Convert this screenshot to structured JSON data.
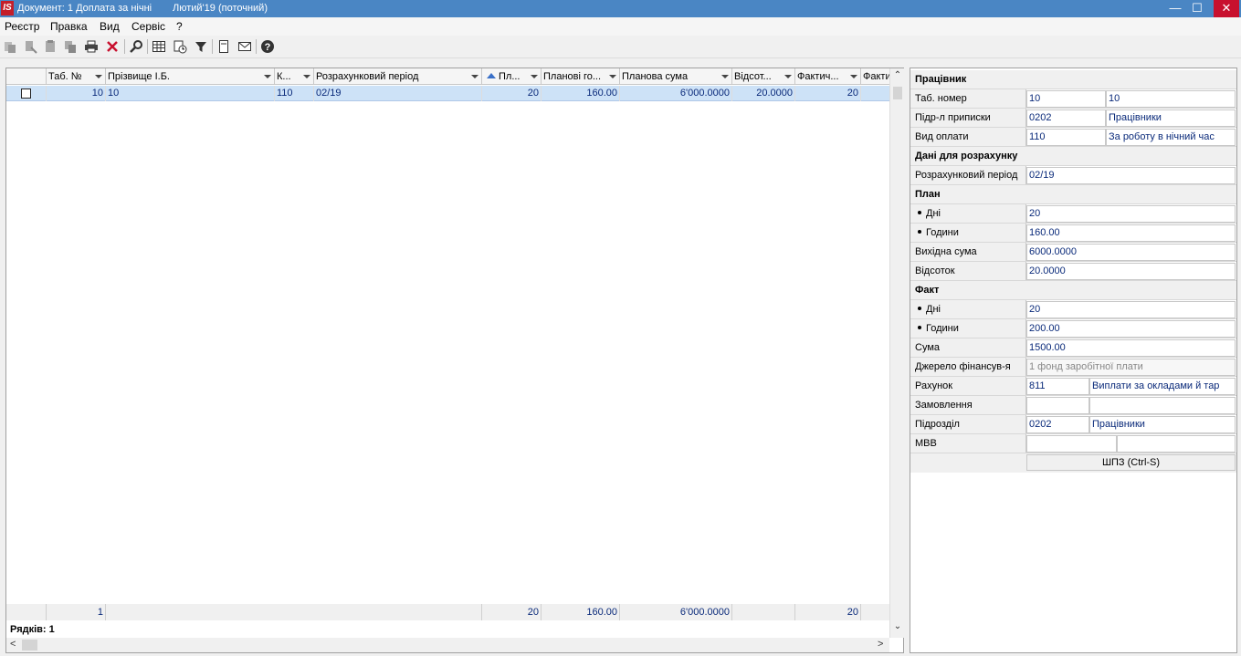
{
  "window": {
    "logo": "IS",
    "title": "Документ: 1 Доплата за нічні",
    "period": "Лютий'19 (поточний)",
    "minimize": "—",
    "maximize": "☐",
    "close": "✕"
  },
  "menu": {
    "items": [
      "Реєстр",
      "Правка",
      "Вид",
      "Сервіс",
      "?"
    ]
  },
  "toolbar": {
    "icons": [
      "copy-doc-icon",
      "cut-doc-icon",
      "paste-doc-icon",
      "duplicate-doc-icon",
      "print-icon",
      "delete-icon",
      "search-icon",
      "table-view-icon",
      "calc-icon",
      "filter-icon",
      "form-icon",
      "mail-icon",
      "help-icon"
    ],
    "colors": {
      "delete": "#c8102e",
      "icon": "#333333"
    }
  },
  "grid": {
    "columns": [
      "Таб. №",
      "Прізвище І.Б.",
      "К...",
      "Розрахунковий період",
      "Пл...",
      "Планові го...",
      "Планова сума",
      "Відсот...",
      "Фактич...",
      "Факти"
    ],
    "rows": [
      {
        "tab": "10",
        "name": "10",
        "code": "110",
        "period": "02/19",
        "plan_days": "20",
        "plan_hours": "160.00",
        "plan_sum": "6'000.0000",
        "percent": "20.0000",
        "fact_days": "20",
        "fact_more": ""
      }
    ],
    "footer": {
      "tab": "1",
      "plan_days": "20",
      "plan_hours": "160.00",
      "plan_sum": "6'000.0000",
      "fact_days": "20"
    },
    "rows_label": "Рядків: 1",
    "scroll_up": "⌃",
    "scroll_down": "⌄",
    "scroll_left": "<",
    "scroll_right": ">"
  },
  "panel": {
    "worker_section": "Працівник",
    "tab_label": "Таб. номер",
    "tab_code": "10",
    "tab_name": "10",
    "dept_label": "Підр-л приписки",
    "dept_code": "0202",
    "dept_name": "Працівники",
    "pay_label": "Вид оплати",
    "pay_code": "110",
    "pay_name": "За роботу в нічний час",
    "calc_section": "Дані для розрахунку",
    "period_label": "Розрахунковий період",
    "period_value": "02/19",
    "plan_section": "План",
    "plan_days_label": "Дні",
    "plan_days_value": "20",
    "plan_hours_label": "Години",
    "plan_hours_value": "160.00",
    "base_sum_label": "Вихідна сума",
    "base_sum_value": "6000.0000",
    "percent_label": "Відсоток",
    "percent_value": "20.0000",
    "fact_section": "Факт",
    "fact_days_label": "Дні",
    "fact_days_value": "20",
    "fact_hours_label": "Години",
    "fact_hours_value": "200.00",
    "sum_label": "Сума",
    "sum_value": "1500.00",
    "source_label": "Джерело фінансув-я",
    "source_value": "1 фонд заробітної плати",
    "account_label": "Рахунок",
    "account_code": "811",
    "account_name": "Виплати за окладами й тар",
    "order_label": "Замовлення",
    "order_code": "",
    "order_name": "",
    "subdiv_label": "Підрозділ",
    "subdiv_code": "0202",
    "subdiv_name": "Працівники",
    "mvv_label": "МВВ",
    "mvv_code": "",
    "mvv_name": "",
    "shortcut": "ШПЗ (Ctrl-S)"
  }
}
